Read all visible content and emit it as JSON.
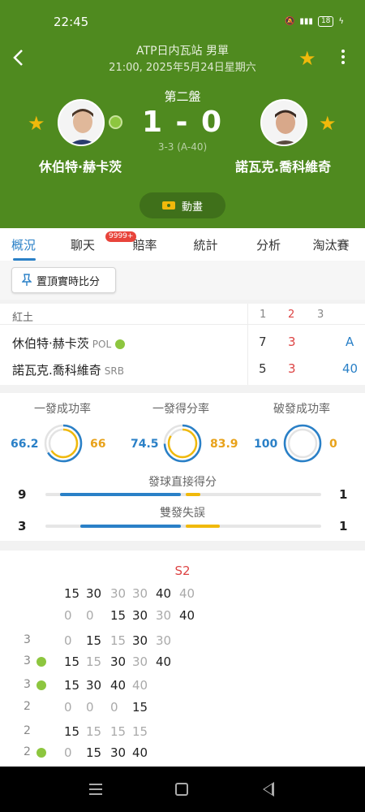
{
  "statusbar": {
    "time": "22:45",
    "battery": "18"
  },
  "header": {
    "tournament": "ATP日内瓦站 男單",
    "datetime": "21:00, 2025年5月24日星期六",
    "set_label": "第二盤",
    "score": "1 - 0",
    "game_score": "3-3 (A-40)",
    "player1": "休伯特·赫卡茨",
    "player2": "諾瓦克.喬科維奇",
    "animation_label": "動畫"
  },
  "tabs": [
    {
      "label": "概況"
    },
    {
      "label": "聊天",
      "badge": "9999+"
    },
    {
      "label": "賠率"
    },
    {
      "label": "統計"
    },
    {
      "label": "分析"
    },
    {
      "label": "淘汰賽"
    }
  ],
  "pin_label": "置頂實時比分",
  "score_table": {
    "surface": "紅土",
    "cols": [
      "1",
      "2",
      "3"
    ],
    "rows": [
      {
        "name": "休伯特·赫卡茨",
        "country": "POL",
        "s1": "7",
        "s2": "3",
        "pts": "A"
      },
      {
        "name": "諾瓦克.喬科維奇",
        "country": "SRB",
        "s1": "5",
        "s2": "3",
        "pts": "40"
      }
    ]
  },
  "stats": {
    "rings": [
      {
        "title": "一發成功率",
        "left": "66.2",
        "right": "66",
        "left_frac": 0.662,
        "right_frac": 0.66
      },
      {
        "title": "一發得分率",
        "left": "74.5",
        "right": "83.9",
        "left_frac": 0.745,
        "right_frac": 0.839
      },
      {
        "title": "破發成功率",
        "left": "100",
        "right": "0",
        "left_frac": 1.0,
        "right_frac": 0.0
      }
    ],
    "bars": [
      {
        "title": "發球直接得分",
        "left": "9",
        "right": "1",
        "left_val": 9,
        "right_val": 1
      },
      {
        "title": "雙發失誤",
        "left": "3",
        "right": "1",
        "left_val": 3,
        "right_val": 1
      }
    ]
  },
  "pbp": {
    "set": "S2",
    "rows": [
      {
        "game": "",
        "serve": false,
        "pts": [
          [
            "15",
            1
          ],
          [
            "30",
            1
          ],
          [
            "30",
            0
          ],
          [
            "30",
            0
          ],
          [
            "40",
            1
          ],
          [
            "40",
            0
          ]
        ]
      },
      {
        "game": "",
        "serve": false,
        "pts": [
          [
            "0",
            0
          ],
          [
            "0",
            0
          ],
          [
            "15",
            1
          ],
          [
            "30",
            1
          ],
          [
            "30",
            0
          ],
          [
            "40",
            1
          ]
        ]
      },
      {
        "game": "3",
        "serve": false,
        "pts": [
          [
            "0",
            0
          ],
          [
            "15",
            1
          ],
          [
            "15",
            0
          ],
          [
            "30",
            1
          ],
          [
            "30",
            0
          ]
        ]
      },
      {
        "game": "3",
        "serve": true,
        "pts": [
          [
            "15",
            1
          ],
          [
            "15",
            0
          ],
          [
            "30",
            1
          ],
          [
            "30",
            0
          ],
          [
            "40",
            1
          ]
        ]
      },
      {
        "game": "3",
        "serve": true,
        "pts": [
          [
            "15",
            1
          ],
          [
            "30",
            1
          ],
          [
            "40",
            1
          ],
          [
            "40",
            0
          ]
        ]
      },
      {
        "game": "2",
        "serve": false,
        "pts": [
          [
            "0",
            0
          ],
          [
            "0",
            0
          ],
          [
            "0",
            0
          ],
          [
            "15",
            1
          ]
        ]
      },
      {
        "game": "2",
        "serve": false,
        "pts": [
          [
            "15",
            1
          ],
          [
            "15",
            0
          ],
          [
            "15",
            0
          ],
          [
            "15",
            0
          ]
        ]
      },
      {
        "game": "2",
        "serve": true,
        "pts": [
          [
            "0",
            0
          ],
          [
            "15",
            1
          ],
          [
            "30",
            1
          ],
          [
            "40",
            1
          ]
        ]
      }
    ]
  },
  "colors": {
    "header_green": "#4f8a1f",
    "accent_blue": "#2a80c7",
    "accent_orange": "#f0b90b",
    "red": "#dd4444"
  }
}
